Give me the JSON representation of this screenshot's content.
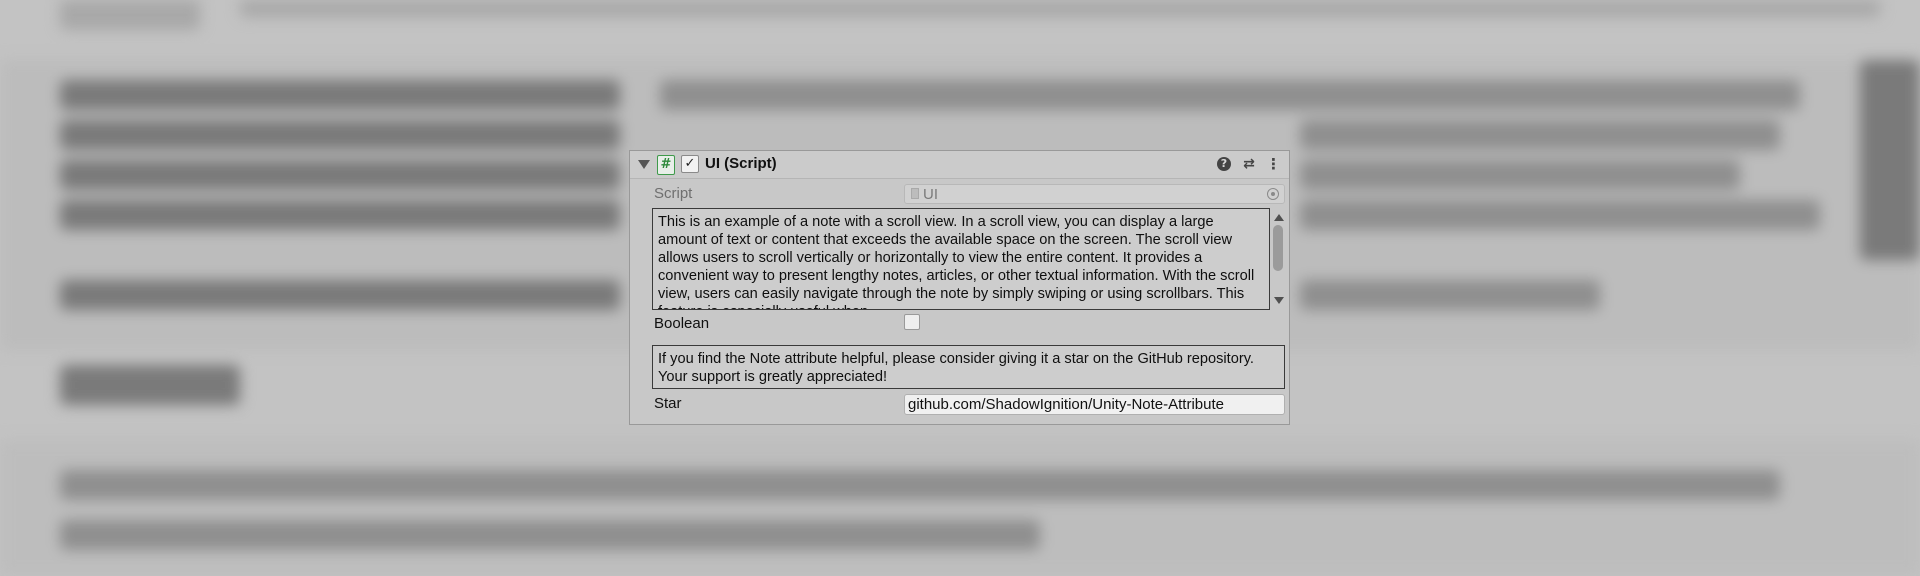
{
  "component": {
    "title": "UI (Script)",
    "enabled": true,
    "script_icon": "#",
    "check_mark": "✓",
    "help_icon": "?",
    "presets_icon": "⇄",
    "more_icon": "⋮"
  },
  "fields": {
    "script": {
      "label": "Script",
      "value": "UI"
    },
    "scroll_note": {
      "text": "This is an example of a note with a scroll view. In a scroll view, you can display a large amount of text or content that exceeds the available space on the screen. The scroll view allows users to scroll vertically or horizontally to view the entire content. It provides a convenient way to present lengthy notes, articles, or other textual information. With the scroll view, users can easily navigate through the note by simply swiping or using scrollbars. This feature is especially useful when"
    },
    "boolean": {
      "label": "Boolean",
      "checked": false
    },
    "star_note": {
      "text": "If you find the Note attribute helpful, please consider giving it a star on the GitHub repository. Your support is greatly appreciated!"
    },
    "star": {
      "label": "Star",
      "value": "github.com/ShadowIgnition/Unity-Note-Attribute"
    }
  },
  "colors": {
    "panel_bg": "#c8c8c8",
    "script_icon_green": "#3f9a4b",
    "note_border": "#3a3a3a"
  }
}
